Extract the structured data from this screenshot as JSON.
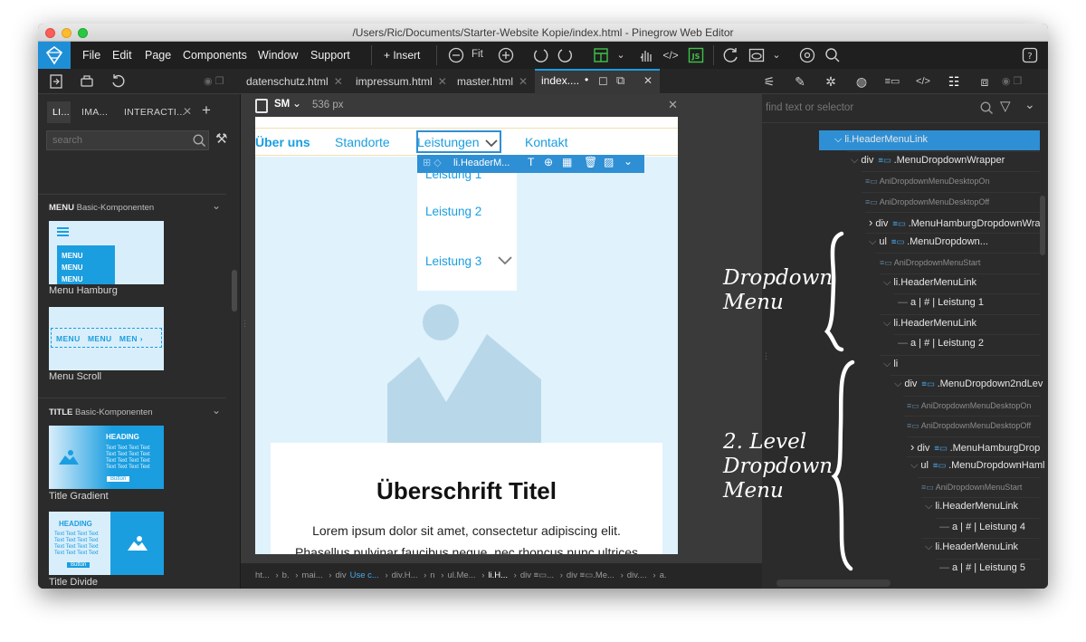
{
  "window": {
    "title": "/Users/Ric/Documents/Starter-Website Kopie/index.html - Pinegrow Web Editor"
  },
  "menu": {
    "items": [
      "File",
      "Edit",
      "Page",
      "Components",
      "Window",
      "Support"
    ],
    "insert_label": "+ Insert",
    "fit_label": "Fit",
    "js_label": "JS"
  },
  "file_tabs": [
    {
      "label": "datenschutz.html"
    },
    {
      "label": "impressum.html"
    },
    {
      "label": "master.html"
    },
    {
      "label": "index....",
      "active": true
    }
  ],
  "left_panel": {
    "tabs": [
      "LI...",
      "IMA...",
      "INTERACTI..."
    ],
    "search_placeholder": "search",
    "sections": [
      {
        "title": "MENU",
        "subtitle": "Basic-Komponenten",
        "items": [
          {
            "label": "Menu Hamburg",
            "thumb_lines": [
              "MENU",
              "MENU",
              "MENU"
            ]
          },
          {
            "label": "Menu Scroll",
            "thumb_lines": [
              "MENU",
              "MENU",
              "MEN"
            ]
          }
        ]
      },
      {
        "title": "TITLE",
        "subtitle": "Basic-Komponenten",
        "items": [
          {
            "label": "Title Gradient",
            "thumb_heading": "HEADING",
            "thumb_button": "Button"
          },
          {
            "label": "Title Divide",
            "thumb_heading": "HEADING",
            "thumb_button": "Button"
          }
        ]
      }
    ],
    "thumb_text": "Text Text Text Text"
  },
  "center": {
    "device_label": "SM",
    "width_label": "536 px",
    "nav": [
      "Über uns",
      "Standorte",
      "Leistungen",
      "Kontakt"
    ],
    "selected_element": "li.HeaderM...",
    "dropdown_items": [
      "Leistung 1",
      "Leistung 2",
      "Leistung 3"
    ],
    "heading": "Überschrift Titel",
    "paragraph_lines": [
      "Lorem ipsum dolor sit amet, consectetur adipiscing elit.",
      "Phasellus pulvinar faucibus neque, nec rhoncus nunc ultrices"
    ],
    "breadcrumb": [
      "ht...",
      "b.",
      "mai...",
      "div",
      "Use c...",
      "div.H...",
      "n",
      "ul.Me...",
      "li.H...",
      "div ≡▭...",
      "div ≡▭.Me...",
      "div....",
      "a."
    ]
  },
  "right_panel": {
    "search_placeholder": "find text or selector",
    "tree": [
      {
        "text": "li.HeaderMenuLink",
        "kind": "selected"
      },
      {
        "text": "div",
        "cls": "≡▭ .MenuDropdownWrapper",
        "kind": "open"
      },
      {
        "text": "AniDropdownMenuDesktopOn",
        "kind": "small"
      },
      {
        "text": "AniDropdownMenuDesktopOff",
        "kind": "small"
      },
      {
        "text": "div",
        "cls": "≡▭ .MenuHamburgDropdownWra",
        "kind": "closed"
      },
      {
        "text": "ul",
        "cls": "≡▭ .MenuDropdown...",
        "kind": "open"
      },
      {
        "text": "AniDropdownMenuStart",
        "kind": "small"
      },
      {
        "text": "li.HeaderMenuLink",
        "kind": "open"
      },
      {
        "text": "a | # | Leistung 1",
        "kind": "leaf"
      },
      {
        "text": "li.HeaderMenuLink",
        "kind": "open"
      },
      {
        "text": "a | # | Leistung 2",
        "kind": "leaf"
      },
      {
        "text": "li",
        "kind": "open"
      },
      {
        "text": "div",
        "cls": "≡▭ .MenuDropdown2ndLev",
        "kind": "open"
      },
      {
        "text": "AniDropdownMenuDesktopOn",
        "kind": "small"
      },
      {
        "text": "AniDropdownMenuDesktopOff",
        "kind": "small"
      },
      {
        "text": "div",
        "cls": "≡▭ .MenuHamburgDrop",
        "kind": "closed"
      },
      {
        "text": "ul",
        "cls": "≡▭ .MenuDropdownHaml",
        "kind": "open"
      },
      {
        "text": "AniDropdownMenuStart",
        "kind": "small"
      },
      {
        "text": "li.HeaderMenuLink",
        "kind": "open"
      },
      {
        "text": "a | # | Leistung 4",
        "kind": "leaf"
      },
      {
        "text": "li.HeaderMenuLink",
        "kind": "open"
      },
      {
        "text": "a | # | Leistung 5",
        "kind": "leaf"
      }
    ]
  },
  "annotations": {
    "dropdown": [
      "Dropdown",
      "Menu"
    ],
    "level2": [
      "2. Level",
      "Dropdown",
      "Menu"
    ]
  },
  "colors": {
    "accent": "#1a9ee0",
    "selection": "#2f8fd4",
    "toolbar_green": "#3fc24a"
  }
}
